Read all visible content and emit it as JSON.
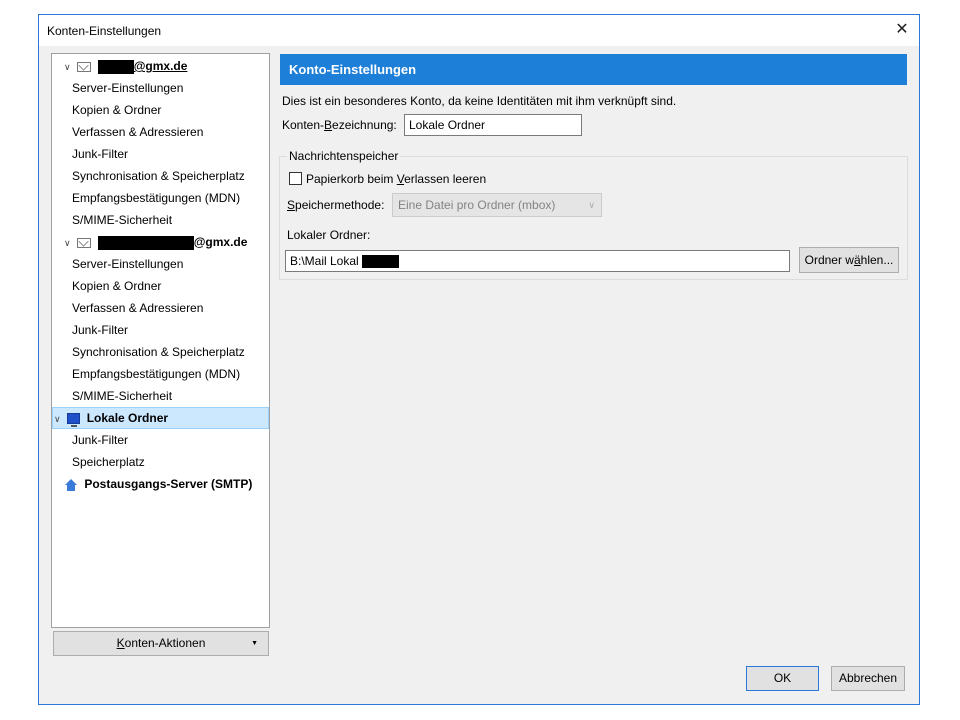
{
  "window": {
    "title": "Konten-Einstellungen",
    "close_glyph": "✕"
  },
  "tree": {
    "accounts": [
      {
        "label_suffix": "@gmx.de",
        "children": [
          "Server-Einstellungen",
          "Kopien & Ordner",
          "Verfassen & Adressieren",
          "Junk-Filter",
          "Synchronisation & Speicherplatz",
          "Empfangsbestätigungen (MDN)",
          "S/MIME-Sicherheit"
        ]
      },
      {
        "label_suffix": "@gmx.de",
        "children": [
          "Server-Einstellungen",
          "Kopien & Ordner",
          "Verfassen & Adressieren",
          "Junk-Filter",
          "Synchronisation & Speicherplatz",
          "Empfangsbestätigungen (MDN)",
          "S/MIME-Sicherheit"
        ]
      }
    ],
    "local_folders": {
      "label": "Lokale Ordner",
      "children": [
        "Junk-Filter",
        "Speicherplatz"
      ]
    },
    "smtp": "Postausgangs-Server (SMTP)"
  },
  "account_actions": {
    "label_u": "K",
    "label_rest": "onten-Aktionen"
  },
  "panel": {
    "header": "Konto-Einstellungen",
    "info": "Dies ist ein besonderes Konto, da keine Identitäten mit ihm verknüpft sind.",
    "name_label_pre": "Konten-",
    "name_label_u": "B",
    "name_label_post": "ezeichnung:",
    "name_value": "Lokale Ordner",
    "storage_group": "Nachrichtenspeicher",
    "empty_trash_pre": "Papierkorb beim ",
    "empty_trash_u": "V",
    "empty_trash_post": "erlassen leeren",
    "empty_trash_checked": false,
    "method_label_u": "S",
    "method_label_post": "peichermethode:",
    "method_value": "Eine Datei pro Ordner (mbox)",
    "local_dir_label": "Lokaler Ordner:",
    "local_dir_value": "B:\\Mail Lokal",
    "choose_pre": "Ordner w",
    "choose_u": "ä",
    "choose_post": "hlen..."
  },
  "buttons": {
    "ok": "OK",
    "cancel": "Abbrechen"
  },
  "colors": {
    "accent": "#1e7fd9",
    "selection": "#cce8ff"
  }
}
